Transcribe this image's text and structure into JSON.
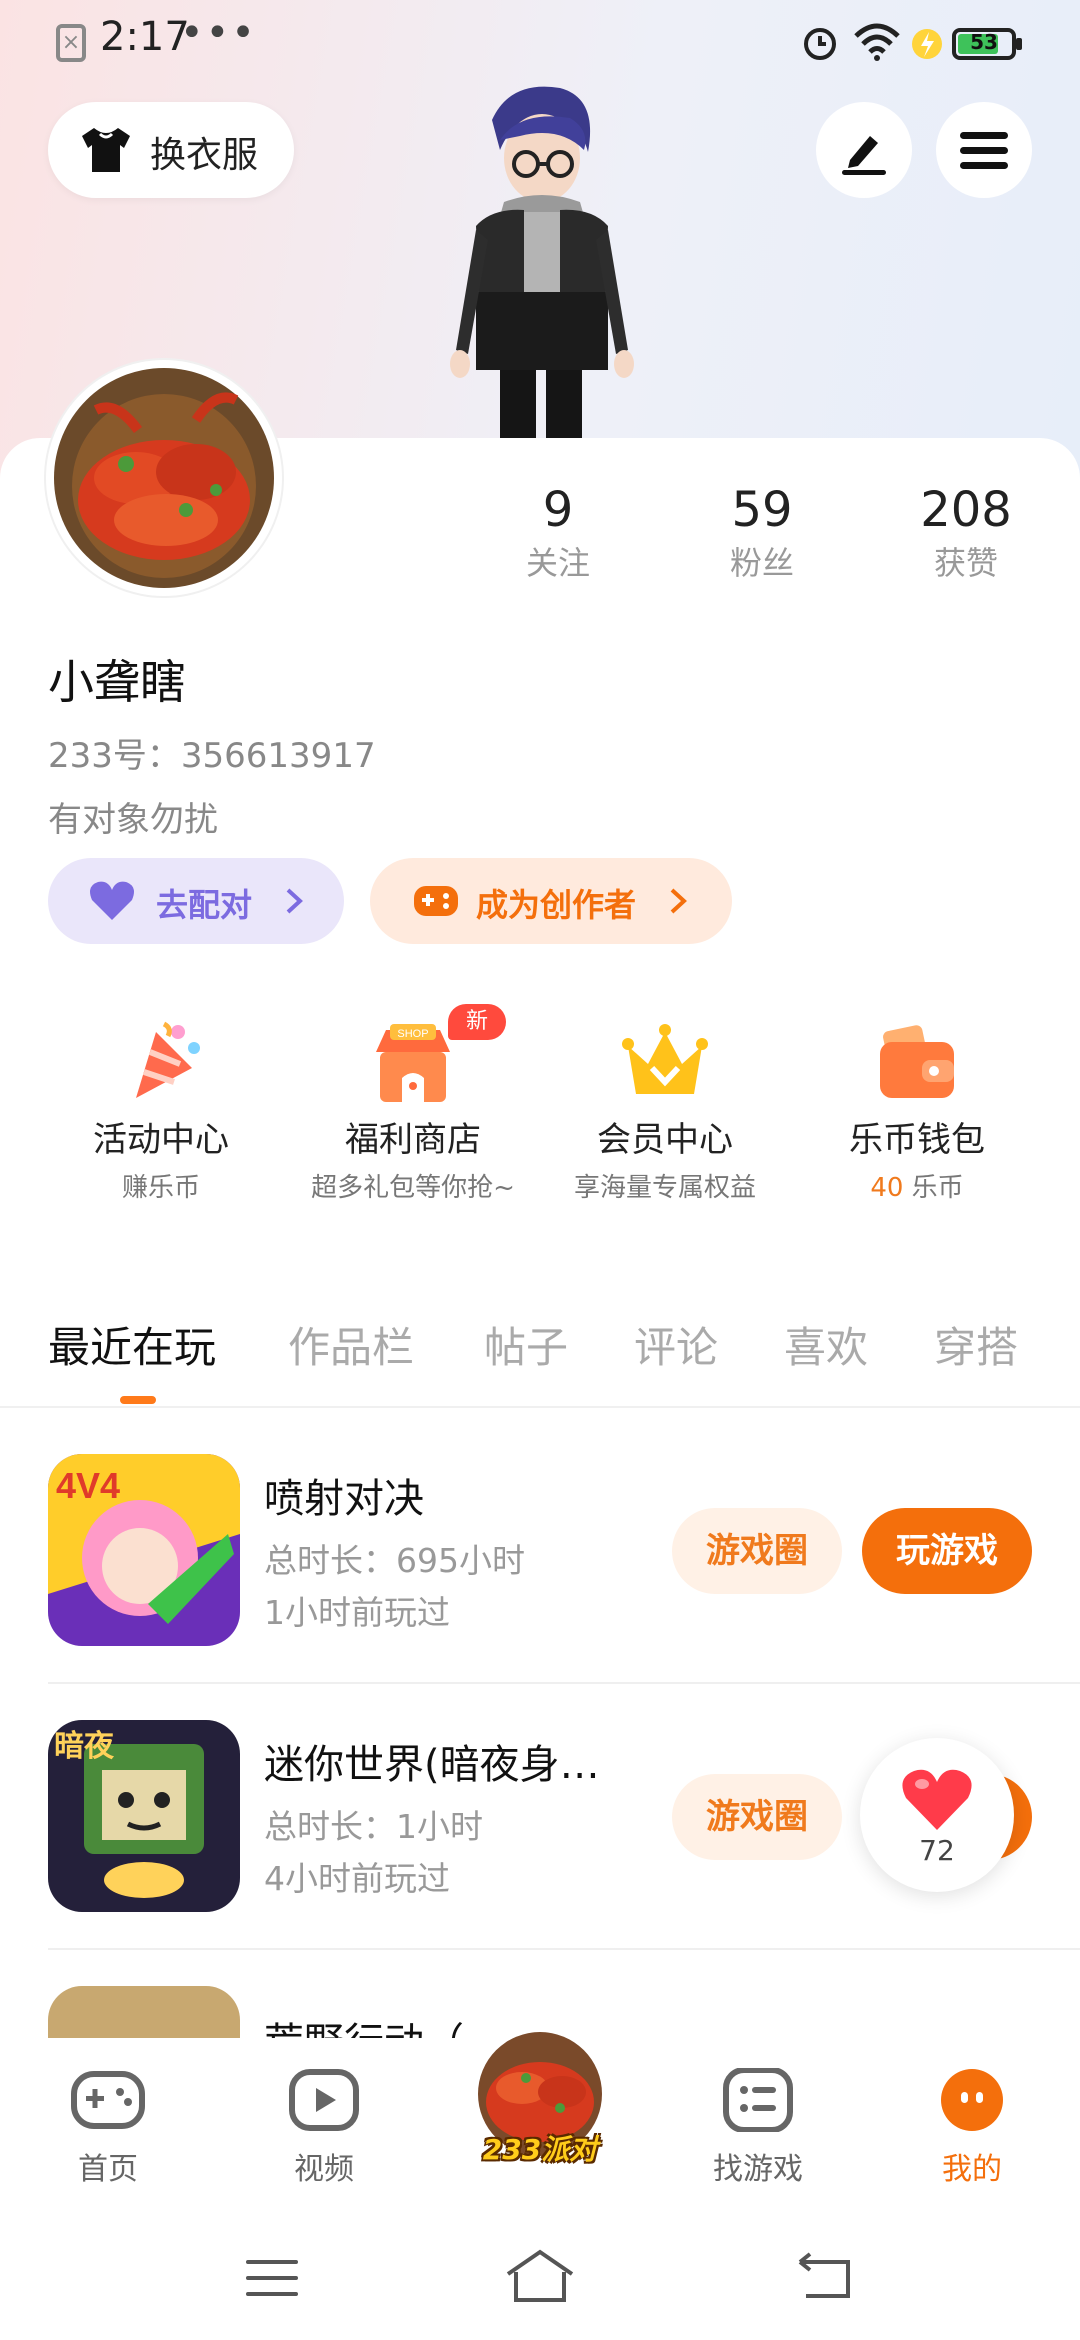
{
  "status_bar": {
    "time": "2:17",
    "dots": "•••",
    "battery": "53"
  },
  "top": {
    "outfit_label": "换衣服"
  },
  "profile": {
    "name": "小聋瞎",
    "uid": "233号：356613917",
    "bio": "有对象勿扰",
    "stats": [
      {
        "value": "9",
        "label": "关注"
      },
      {
        "value": "59",
        "label": "粉丝"
      },
      {
        "value": "208",
        "label": "获赞"
      }
    ],
    "match_label": "去配对",
    "creator_label": "成为创作者"
  },
  "entries": [
    {
      "title": "活动中心",
      "sub": "赚乐币"
    },
    {
      "title": "福利商店",
      "sub": "超多礼包等你抢~",
      "badge": "新"
    },
    {
      "title": "会员中心",
      "sub": "享海量专属权益"
    },
    {
      "title": "乐币钱包",
      "sub_num": "40",
      "sub": "乐币"
    }
  ],
  "tabs": [
    "最近在玩",
    "作品栏",
    "帖子",
    "评论",
    "喜欢",
    "穿搭"
  ],
  "games": [
    {
      "name": "喷射对决",
      "duration": "总时长：695小时",
      "last": "1小时前玩过",
      "circle_label": "游戏圈",
      "play_label": "玩游戏"
    },
    {
      "name": "迷你世界(暗夜身…",
      "duration": "总时长：1小时",
      "last": "4小时前玩过",
      "circle_label": "游戏圈"
    },
    {
      "name": "荒野行动（"
    }
  ],
  "like_count": "72",
  "nav": [
    {
      "label": "首页"
    },
    {
      "label": "视频"
    },
    {
      "label": "233派对"
    },
    {
      "label": "找游戏"
    },
    {
      "label": "我的"
    }
  ],
  "colors": {
    "accent": "#f46f0c",
    "purple": "#7c6be0"
  }
}
